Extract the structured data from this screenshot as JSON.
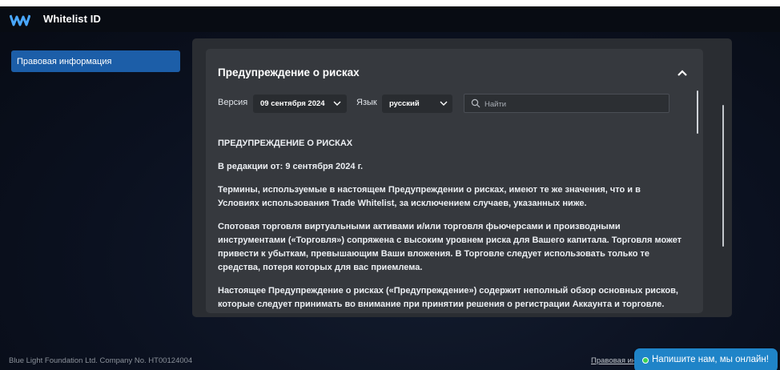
{
  "app": {
    "title": "Whitelist ID"
  },
  "sidebar": {
    "items": [
      {
        "label": "Правовая информация",
        "active": true
      }
    ]
  },
  "section": {
    "title": "Предупреждение о рисках",
    "version_label": "Версия",
    "version_value": "09 сентября 2024",
    "language_label": "Язык",
    "language_value": "русский",
    "search_placeholder": "Найти"
  },
  "document": {
    "heading": "ПРЕДУПРЕЖДЕНИЕ О РИСКАХ",
    "edition": "В редакции от: 9 сентября 2024 г.",
    "paragraphs": [
      "Термины, используемые в настоящем Предупреждении о рисках, имеют те же значения, что и в Условиях использования Trade Whitelist, за исключением случаев, указанных ниже.",
      "Спотовая торговля виртуальными активами и/или торговля фьючерсами и производными инструментами («Торговля») сопряжена с высоким уровнем риска для Вашего капитала. Торговля может привести к убыткам, превышающим Ваши вложения. В Торговле следует использовать только те средства, потеря которых для вас приемлема.",
      "Настоящее Предупреждение о рисках («Предупреждение») содержит неполный обзор основных рисков, которые следует принимать во внимание при принятии решения о регистрации Аккаунта и торговле."
    ]
  },
  "footer": {
    "company": "Blue Light Foundation Ltd. Company No. HT00124004",
    "legal_link": "Правовая информация"
  },
  "chat": {
    "label": "Напишите нам, мы онлайн!",
    "status_color": "#39d353"
  },
  "colors": {
    "accent": "#1c5ea8",
    "chat": "#1f84c8"
  }
}
